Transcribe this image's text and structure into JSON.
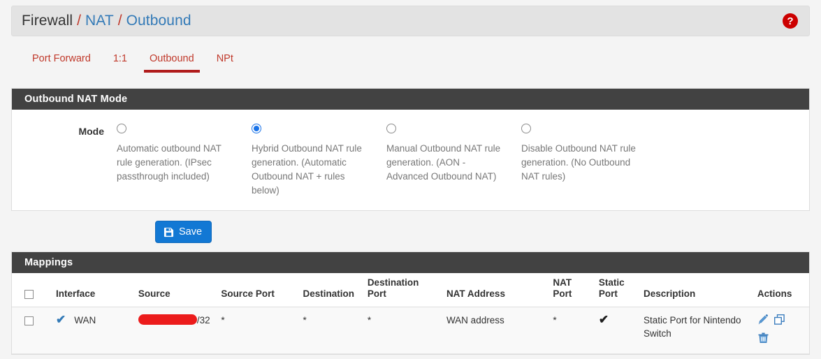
{
  "breadcrumb": {
    "items": [
      {
        "label": "Firewall",
        "link": false
      },
      {
        "label": "NAT",
        "link": true
      },
      {
        "label": "Outbound",
        "link": true
      }
    ],
    "separator": "/",
    "help_icon": "question-mark-circle-icon",
    "help_glyph": "?"
  },
  "tabs": [
    {
      "label": "Port Forward",
      "active": false
    },
    {
      "label": "1:1",
      "active": false
    },
    {
      "label": "Outbound",
      "active": true
    },
    {
      "label": "NPt",
      "active": false
    }
  ],
  "mode_panel": {
    "title": "Outbound NAT Mode",
    "field_label": "Mode",
    "options": [
      {
        "id": "automatic",
        "selected": false,
        "description": "Automatic outbound NAT rule generation. (IPsec passthrough included)"
      },
      {
        "id": "hybrid",
        "selected": true,
        "description": "Hybrid Outbound NAT rule generation. (Automatic Outbound NAT + rules below)"
      },
      {
        "id": "manual",
        "selected": false,
        "description": "Manual Outbound NAT rule generation. (AON - Advanced Outbound NAT)"
      },
      {
        "id": "disabled",
        "selected": false,
        "description": "Disable Outbound NAT rule generation. (No Outbound NAT rules)"
      }
    ],
    "save_label": "Save",
    "save_icon": "save-floppy-icon"
  },
  "mappings_panel": {
    "title": "Mappings",
    "columns": [
      "Interface",
      "Source",
      "Source Port",
      "Destination",
      "Destination Port",
      "NAT Address",
      "NAT Port",
      "Static Port",
      "Description",
      "Actions"
    ],
    "rows": [
      {
        "selected": false,
        "enabled_icon": "check-icon",
        "interface": "WAN",
        "source_redacted": true,
        "source_suffix": "/32",
        "source_port": "*",
        "destination": "*",
        "destination_port": "*",
        "nat_address": "WAN address",
        "nat_port": "*",
        "static_port_icon": "check-icon",
        "description": "Static Port for Nintendo Switch",
        "actions": [
          "edit-pencil-icon",
          "copy-clone-icon",
          "delete-trash-icon"
        ]
      }
    ]
  },
  "colors": {
    "page_bg": "#f4f4f4",
    "breadcrumb_bg": "#e3e3e3",
    "link": "#337ab7",
    "tab_text": "#c0392b",
    "tab_active_underline": "#b01b1b",
    "panel_heading_bg": "#424242",
    "primary_button": "#1278d4",
    "radio_selected": "#1a73e8",
    "help_icon_bg": "#cc0000",
    "redaction": "#ec1c1c",
    "row_bg": "#f9f9f9"
  }
}
